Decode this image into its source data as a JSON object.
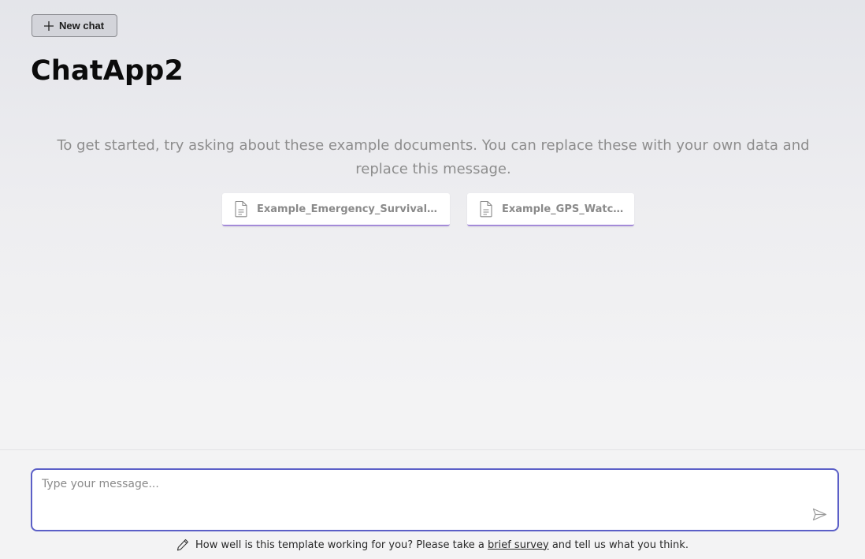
{
  "toolbar": {
    "new_chat_label": "New chat",
    "new_chat_icon": "plus-icon"
  },
  "app": {
    "title": "ChatApp2"
  },
  "intro": {
    "message": "To get started, try asking about these example documents. You can replace these with your own data and replace this message."
  },
  "documents": [
    {
      "name": "Example_Emergency_Survival_Kit.pdf",
      "icon": "document-icon"
    },
    {
      "name": "Example_GPS_Watch.pdf",
      "icon": "document-icon"
    }
  ],
  "composer": {
    "placeholder": "Type your message...",
    "value": "",
    "send_icon": "send-icon"
  },
  "footer": {
    "icon": "pencil-icon",
    "text_before": "How well is this template working for you? Please take a",
    "link_text": "brief survey",
    "text_after": "and tell us what you think."
  },
  "colors": {
    "accent": "#5b5fc7",
    "doc_card_underline": "#a48bd8",
    "button_bg": "#d3d4da"
  }
}
